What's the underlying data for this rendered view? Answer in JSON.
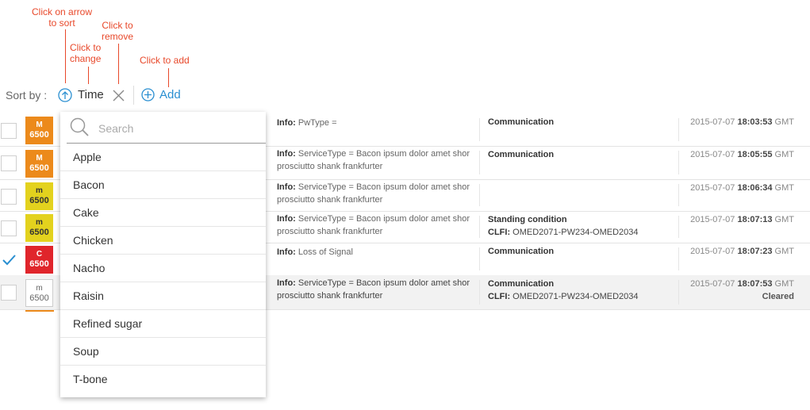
{
  "annotations": {
    "sort": "Click on arrow\nto sort",
    "change": "Click to\nchange",
    "remove": "Click to\nremove",
    "add": "Click to add"
  },
  "sortbar": {
    "label": "Sort by :",
    "field": "Time",
    "add_label": "Add",
    "accent_color": "#2a8fd1"
  },
  "rows": [
    {
      "checked": false,
      "severity": "M",
      "code": "6500",
      "info_label": "Info:",
      "info": "PwType =",
      "info2": "",
      "category": "Communication",
      "clfi_label": "",
      "clfi": "",
      "date": "2015-07-07",
      "time": "18:03:53",
      "tz": "GMT",
      "status": ""
    },
    {
      "checked": false,
      "severity": "M",
      "code": "6500",
      "info_label": "Info:",
      "info": "ServiceType = Bacon ipsum dolor amet shor",
      "info2": "prosciutto shank frankfurter",
      "category": "Communication",
      "clfi_label": "",
      "clfi": "",
      "date": "2015-07-07",
      "time": "18:05:55",
      "tz": "GMT",
      "status": ""
    },
    {
      "checked": false,
      "severity": "m",
      "code": "6500",
      "info_label": "Info:",
      "info": "ServiceType = Bacon ipsum dolor amet shor",
      "info2": "prosciutto shank frankfurter",
      "category": "",
      "clfi_label": "",
      "clfi": "",
      "date": "2015-07-07",
      "time": "18:06:34",
      "tz": "GMT",
      "status": ""
    },
    {
      "checked": false,
      "severity": "m",
      "code": "6500",
      "info_label": "Info:",
      "info": "ServiceType = Bacon ipsum dolor amet shor",
      "info2": "prosciutto shank frankfurter",
      "category": "Standing condition",
      "clfi_label": "CLFI:",
      "clfi": "OMED2071-PW234-OMED2034",
      "date": "2015-07-07",
      "time": "18:07:13",
      "tz": "GMT",
      "status": ""
    },
    {
      "checked": true,
      "severity": "C",
      "code": "6500",
      "info_label": "Info:",
      "info": "Loss of Signal",
      "info2": "",
      "category": "Communication",
      "clfi_label": "",
      "clfi": "",
      "date": "2015-07-07",
      "time": "18:07:23",
      "tz": "GMT",
      "status": ""
    },
    {
      "checked": false,
      "severity": "m",
      "code": "6500",
      "info_label": "Info:",
      "info": "ServiceType = Bacon ipsum dolor amet shor",
      "info2": "prosciutto shank frankfurter",
      "category": "Communication",
      "clfi_label": "CLFI:",
      "clfi": "OMED2071-PW234-OMED2034",
      "date": "2015-07-07",
      "time": "18:07:53",
      "tz": "GMT",
      "status": "Cleared"
    }
  ],
  "dropdown": {
    "search_placeholder": "Search",
    "items": [
      "Apple",
      "Bacon",
      "Cake",
      "Chicken",
      "Nacho",
      "Raisin",
      "Refined sugar",
      "Soup",
      "T-bone"
    ]
  },
  "colors": {
    "major": "#ec8a1b",
    "minor": "#e3d21e",
    "critical": "#e0252b",
    "annotation": "#e8482a"
  }
}
